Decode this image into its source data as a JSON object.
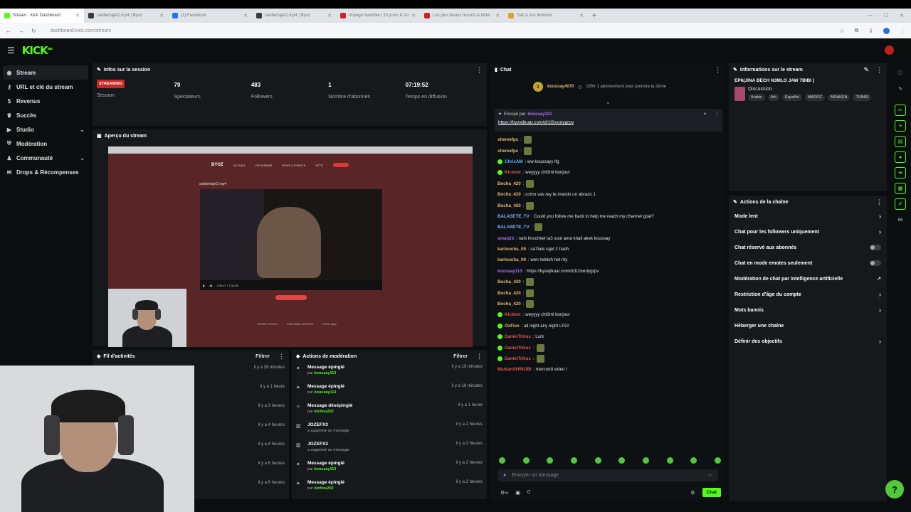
{
  "browser": {
    "tabs": [
      {
        "label": "Stream · Kick Dashboard",
        "color": "#53fc18"
      },
      {
        "label": "sahbelrajel2.mp4 | Byoz",
        "color": "#3a3a3a"
      },
      {
        "label": "(1) Facebook",
        "color": "#1877f2"
      },
      {
        "label": "sahbelrajel2.mp4 | Byoz",
        "color": "#3a3a3a"
      },
      {
        "label": "Voyage Namibie | 10 jours & Vo",
        "color": "#cc2222"
      },
      {
        "label": "Les plus beaux resorts & hôtel",
        "color": "#cc2222"
      },
      {
        "label": "Sab à ses femmes",
        "color": "#e0a030"
      }
    ],
    "url": "dashboard.kick.com/stream"
  },
  "header": {
    "logo": "KICK",
    "logo_sup": "beta"
  },
  "sidebar": {
    "items": [
      {
        "label": "Stream",
        "icon": "broadcast-icon"
      },
      {
        "label": "URL et clé du stream",
        "icon": "key-icon"
      },
      {
        "label": "Revenus",
        "icon": "money-icon"
      },
      {
        "label": "Succès",
        "icon": "trophy-icon"
      },
      {
        "label": "Studio",
        "icon": "studio-icon"
      },
      {
        "label": "Modération",
        "icon": "shield-icon"
      },
      {
        "label": "Communauté",
        "icon": "people-icon"
      },
      {
        "label": "Drops & Récompenses",
        "icon": "gift-icon"
      }
    ]
  },
  "session": {
    "title": "Infos sur la session",
    "badge": "STREAMING",
    "badge_label": "Session",
    "stats": [
      {
        "value": "79",
        "label": "Spectateurs"
      },
      {
        "value": "483",
        "label": "Followers"
      },
      {
        "value": "1",
        "label": "Nombre d'abonnés"
      },
      {
        "value": "07:19:52",
        "label": "Temps en diffusion"
      }
    ]
  },
  "preview": {
    "title": "Aperçu du stream",
    "site_logo": "BYOZ",
    "video_title": "sahbelrajel2.mp4",
    "video_time": "1:09:47 / 1:34:28",
    "nav": [
      "ACCUEIL",
      "PROGRAMS",
      "NEWS & EVENTS",
      "NFTS",
      "PRIVACY POLICY",
      "CUSTOMER SUPPORT"
    ],
    "footer_copy": "© 2024 Byoz"
  },
  "activity": {
    "title": "Fil d'activités",
    "filter": "Filtrer",
    "times": [
      "il y a 26 minutes",
      "il y a 1 heure",
      "il y a 3 heures",
      "il y a 4 heures",
      "il y a 4 heures",
      "il y a 6 heures",
      "il y a 6 heures"
    ]
  },
  "moderation": {
    "title": "Actions de modération",
    "filter": "Filtrer",
    "rows": [
      {
        "icon": "pin-icon",
        "title": "Message épinglé",
        "by": "par",
        "user": "koussay113",
        "time": "il y a 19 minutes"
      },
      {
        "icon": "pin-icon",
        "title": "Message épinglé",
        "by": "par",
        "user": "koussay113",
        "time": "il y a 19 minutes"
      },
      {
        "icon": "unpin-icon",
        "title": "Message désépinglé",
        "by": "par",
        "user": "bichou202",
        "time": "il y a 1 heure"
      },
      {
        "icon": "trash-icon",
        "title": "JOZEFX3",
        "by": "a supprimé un message",
        "user": "",
        "time": "il y a 2 heures"
      },
      {
        "icon": "trash-icon",
        "title": "JOZEFX3",
        "by": "a supprimé un message",
        "user": "",
        "time": "il y a 2 heures"
      },
      {
        "icon": "pin-icon",
        "title": "Message épinglé",
        "by": "par",
        "user": "koussay113",
        "time": "il y a 2 heures"
      },
      {
        "icon": "pin-icon",
        "title": "Message épinglé",
        "by": "par",
        "user": "bichou202",
        "time": "il y a 2 heures"
      }
    ]
  },
  "chat": {
    "title": "Chat",
    "sub_user": "koussay4070",
    "sub_count": "1",
    "sub_text": "Offrir 1 abonnement pour prendre la 2ème",
    "pinned_label": "Envoyé par",
    "pinned_user": "koussay113",
    "pinned_link": "https://byzejlkuar.com/d/1l2xxutygrpv",
    "messages": [
      {
        "user": "shereefps",
        "color": "#e8b86a",
        "text": "",
        "emote": true,
        "verified": false
      },
      {
        "user": "shereefps",
        "color": "#e8b86a",
        "text": "",
        "emote": true,
        "verified": false
      },
      {
        "user": "ChrisAM",
        "color": "#58b9ff",
        "text": ": ww koussayy lfg",
        "emote": false,
        "verified": true
      },
      {
        "user": "Kickbot",
        "color": "#e05353",
        "text": ": weyyyy cht3ml bonjour",
        "emote": false,
        "verified": true
      },
      {
        "user": "Bocha_420",
        "color": "#e8b86a",
        "text": "",
        "emote": true,
        "verified": false
      },
      {
        "user": "Bocha_420",
        "color": "#e8b86a",
        "text": ": como vas rey te mando un abrazo 1",
        "emote": false,
        "verified": false
      },
      {
        "user": "Bocha_420",
        "color": "#e8b86a",
        "text": "",
        "emote": true,
        "verified": false
      },
      {
        "user": "BALASETE_TV",
        "color": "#7fb0ff",
        "text": ": Could you follow me back to help me reach my channel goal?",
        "emote": false,
        "verified": false
      },
      {
        "user": "BALASETE_TV",
        "color": "#7fb0ff",
        "text": "",
        "emote": true,
        "verified": false
      },
      {
        "user": "aman23",
        "color": "#b06bff",
        "text": ": nafs lmochkel ta3 sout ama khali akek koussay",
        "emote": false,
        "verified": false
      },
      {
        "user": "kartoucha_09",
        "color": "#e8b86a",
        "text": ": sa7bek rajel 2 hadh",
        "emote": false,
        "verified": false
      },
      {
        "user": "kartoucha_09",
        "color": "#e8b86a",
        "text": ": wen hebloh het rity",
        "emote": false,
        "verified": false
      },
      {
        "user": "koussay113",
        "color": "#b06bff",
        "text": ": https://byzejlkuar.com/d/1l2xxutygrpv",
        "emote": false,
        "verified": false
      },
      {
        "user": "Bocha_420",
        "color": "#e8b86a",
        "text": "",
        "emote": true,
        "verified": false
      },
      {
        "user": "Bocha_420",
        "color": "#e8b86a",
        "text": "",
        "emote": true,
        "verified": false
      },
      {
        "user": "Bocha_420",
        "color": "#e8b86a",
        "text": "",
        "emote": true,
        "verified": false
      },
      {
        "user": "Kickbot",
        "color": "#e05353",
        "text": ": weyyyy cht3ml bonjour",
        "emote": false,
        "verified": true
      },
      {
        "user": "OxFive",
        "color": "#e8b86a",
        "text": ": all night airy night LFG!",
        "emote": false,
        "verified": true
      },
      {
        "user": "DanielTrikus",
        "color": "#e05353",
        "text": ": Lurk",
        "emote": false,
        "verified": true
      },
      {
        "user": "DanielTrikus",
        "color": "#e05353",
        "text": "",
        "emote": true,
        "verified": true
      },
      {
        "user": "DanielTrikus",
        "color": "#e05353",
        "text": "",
        "emote": true,
        "verified": true
      },
      {
        "user": "MarkanSHINOBI",
        "color": "#e05353",
        "text": ": mercordi video !",
        "emote": false,
        "verified": false
      }
    ],
    "input_placeholder": "Envoyer un message",
    "viewers_small": "0",
    "send_label": "Chat"
  },
  "info": {
    "title": "Informations sur le stream",
    "stream_title": "EP6(JINA BECH N3MLO JAW 7BIBI )",
    "category": "Discussion",
    "tags": [
      "Arabic",
      "Ark",
      "Español",
      "MAROC",
      "MSAKEN",
      "TUNISI"
    ]
  },
  "actions": {
    "title": "Actions de la chaîne",
    "rows": [
      {
        "label": "Mode lent",
        "kind": "arrow"
      },
      {
        "label": "Chat pour les followers uniquement",
        "kind": "arrow"
      },
      {
        "label": "Chat réservé aux abonnés",
        "kind": "toggle"
      },
      {
        "label": "Chat en mode emotes seulement",
        "kind": "toggle"
      },
      {
        "label": "Modération de chat par intelligence artificielle",
        "kind": "external"
      },
      {
        "label": "Restriction d'âge du compte",
        "kind": "arrow"
      },
      {
        "label": "Mots bannis",
        "kind": "arrow"
      },
      {
        "label": "Héberger une chaîne",
        "kind": "none"
      },
      {
        "label": "Définir des objectifs",
        "kind": "arrow"
      }
    ]
  },
  "colors": {
    "accent": "#53fc18",
    "live_badge": "#c82727",
    "panel": "#16191c",
    "bg": "#0b0e0f"
  }
}
